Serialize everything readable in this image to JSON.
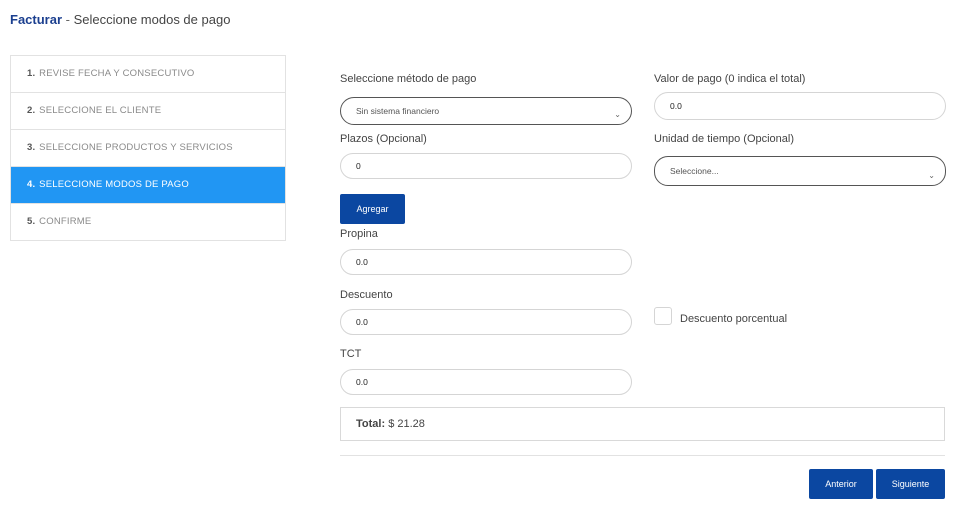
{
  "header": {
    "section": "Facturar",
    "separator": " - ",
    "subtitle": "Seleccione modos de pago"
  },
  "steps": [
    {
      "num": "1.",
      "label": "REVISE FECHA Y CONSECUTIVO"
    },
    {
      "num": "2.",
      "label": "SELECCIONE EL CLIENTE"
    },
    {
      "num": "3.",
      "label": "SELECCIONE PRODUCTOS Y SERVICIOS"
    },
    {
      "num": "4.",
      "label": "SELECCIONE MODOS DE PAGO"
    },
    {
      "num": "5.",
      "label": "CONFIRME"
    }
  ],
  "form": {
    "payment_method": {
      "label": "Seleccione método de pago",
      "value": "Sin sistema financiero"
    },
    "payment_value": {
      "label": "Valor de pago (0 indica el total)",
      "value": "0.0"
    },
    "installments": {
      "label": "Plazos (Opcional)",
      "value": "0"
    },
    "time_unit": {
      "label": "Unidad de tiempo (Opcional)",
      "value": "Seleccione..."
    },
    "add_button": "Agregar",
    "tip": {
      "label": "Propina",
      "value": "0.0"
    },
    "discount": {
      "label": "Descuento",
      "value": "0.0"
    },
    "percent_discount": {
      "label": "Descuento porcentual"
    },
    "tct": {
      "label": "TCT",
      "value": "0.0"
    }
  },
  "total": {
    "label": "Total:",
    "value": "$ 21.28"
  },
  "buttons": {
    "previous": "Anterior",
    "next": "Siguiente"
  },
  "colors": {
    "accent": "#2196f3",
    "primary_button": "#0b47a1",
    "title": "#1b3f8f"
  }
}
